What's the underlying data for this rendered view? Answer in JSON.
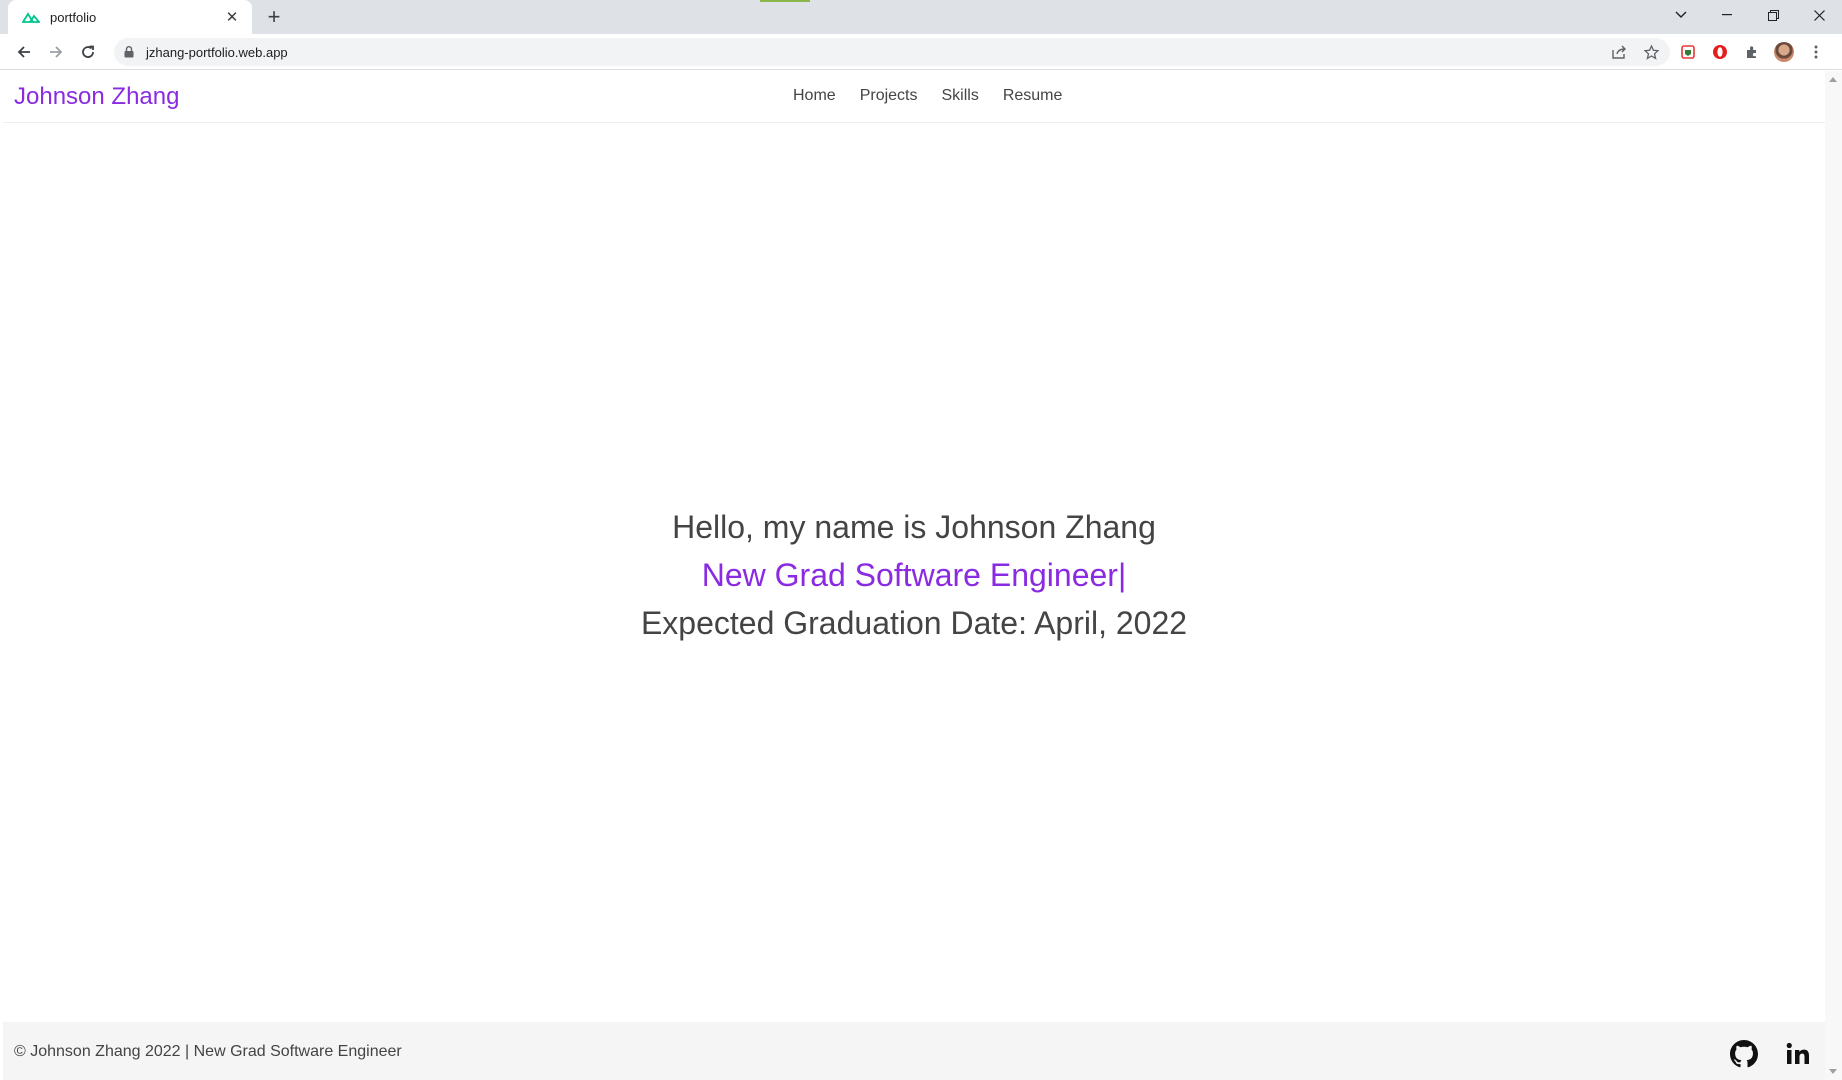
{
  "browser": {
    "tab_title": "portfolio",
    "url": "jzhang-portfolio.web.app",
    "new_tab_label": "+",
    "close_tab_label": "✕"
  },
  "site": {
    "brand": "Johnson Zhang",
    "nav": [
      "Home",
      "Projects",
      "Skills",
      "Resume"
    ],
    "hero": {
      "greeting": "Hello, my name is Johnson Zhang",
      "role": "New Grad Software Engineer|",
      "graduation": "Expected Graduation Date: April, 2022"
    },
    "footer": {
      "text": "© Johnson Zhang 2022 | New Grad Software Engineer"
    }
  },
  "colors": {
    "accent": "#8a2be2",
    "text": "#444444",
    "footer_bg": "#f5f5f5"
  },
  "icons": {
    "favicon": "nuxt-logo-icon",
    "footer": [
      "github-icon",
      "linkedin-icon"
    ]
  }
}
